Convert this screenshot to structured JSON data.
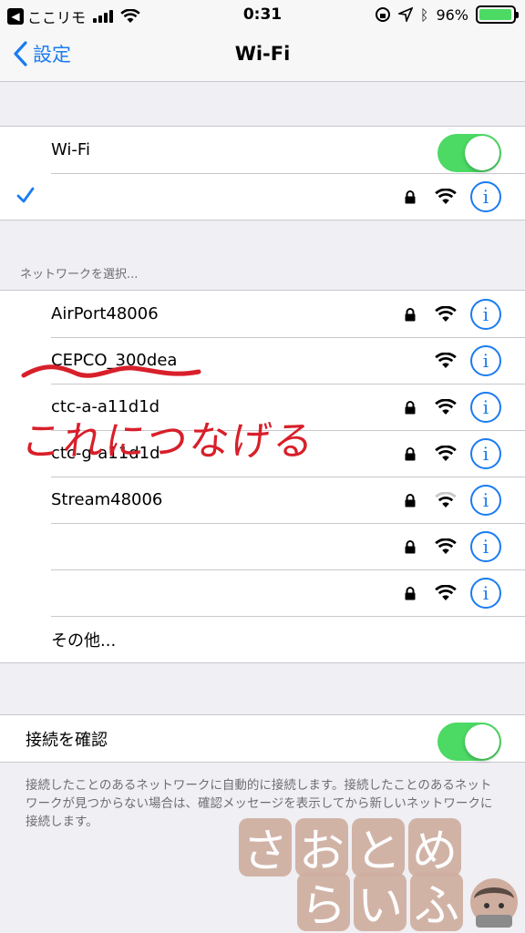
{
  "status_bar": {
    "carrier": "ここリモ",
    "time": "0:31",
    "battery": "96%",
    "battery_level": 0.96
  },
  "nav": {
    "back_label": "設定",
    "title": "Wi-Fi"
  },
  "wifi_toggle": {
    "label": "Wi-Fi",
    "on": true
  },
  "connected_network": {
    "name": "",
    "secured": true
  },
  "choose_network_header": "ネットワークを選択...",
  "networks": [
    {
      "name": "AirPort48006",
      "secured": true
    },
    {
      "name": "CEPCO_300dea",
      "secured": false
    },
    {
      "name": "ctc-a-a11d1d",
      "secured": true
    },
    {
      "name": "ctc-g-a11d1d",
      "secured": true
    },
    {
      "name": "Stream48006",
      "secured": true
    },
    {
      "name": "",
      "secured": true
    },
    {
      "name": "",
      "secured": true
    }
  ],
  "other_label": "その他...",
  "ask_to_join": {
    "label": "接続を確認",
    "on": true,
    "description": "接続したことのあるネットワークに自動的に接続します。接続したことのあるネットワークが見つからない場合は、確認メッセージを表示してから新しいネットワークに接続します。"
  },
  "annotation": "これにつなげる",
  "watermark": {
    "line1": [
      "さ",
      "お",
      "と",
      "め"
    ],
    "line2": [
      "ら",
      "い",
      "ふ"
    ]
  },
  "colors": {
    "accent": "#1a7cf0",
    "toggle_on": "#4cd964",
    "annotation": "#d81f2a",
    "background": "#efeff4"
  }
}
